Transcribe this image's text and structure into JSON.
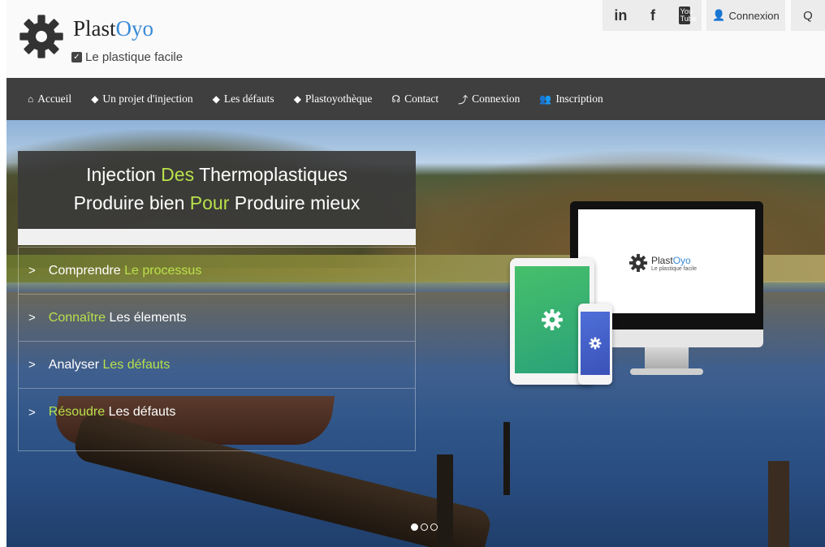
{
  "header": {
    "brand": {
      "prefix": "Plast",
      "accent": "Oyo"
    },
    "tagline": "Le plastique facile",
    "social": {
      "linkedin": "in",
      "facebook": "f",
      "youtube_top": "You",
      "youtube_bottom": "Tube"
    },
    "login_label": "Connexion",
    "search_icon": "search-icon"
  },
  "nav": {
    "items": [
      {
        "icon": "home-icon",
        "glyph": "⌂",
        "label": "Accueil"
      },
      {
        "icon": "tag-icon",
        "glyph": "◆",
        "label": "Un projet d'injection"
      },
      {
        "icon": "tag-icon",
        "glyph": "◆",
        "label": "Les défauts"
      },
      {
        "icon": "tag-icon",
        "glyph": "◆",
        "label": "Plastoyothèque"
      },
      {
        "icon": "headset-icon",
        "glyph": "☊",
        "label": "Contact"
      },
      {
        "icon": "login-icon",
        "glyph": "⤴",
        "label": "Connexion"
      },
      {
        "icon": "users-icon",
        "glyph": "👥",
        "label": "Inscription"
      }
    ]
  },
  "hero": {
    "title_line1": {
      "a": "Injection",
      "b": "Des",
      "c": "Thermoplastiques"
    },
    "title_line2": {
      "a": "Produire bien",
      "b": "Pour",
      "c": "Produire mieux"
    },
    "features": [
      {
        "a": "Comprendre",
        "b": "Le processus",
        "b_green": true
      },
      {
        "a": "Connaître",
        "b": "Les élements",
        "a_green": true
      },
      {
        "a": "Analyser",
        "b": "Les défauts",
        "b_green": true
      },
      {
        "a": "Résoudre",
        "b": "Les défauts",
        "a_green": true
      }
    ],
    "monitor_brand": {
      "prefix": "Plast",
      "accent": "Oyo",
      "tagline": "Le plastique facile"
    },
    "carousel": {
      "count": 3,
      "active": 1
    }
  },
  "colors": {
    "nav_bg": "#3f3f3f",
    "accent_green": "#b8e04a",
    "brand_blue": "#3a8bd6"
  }
}
